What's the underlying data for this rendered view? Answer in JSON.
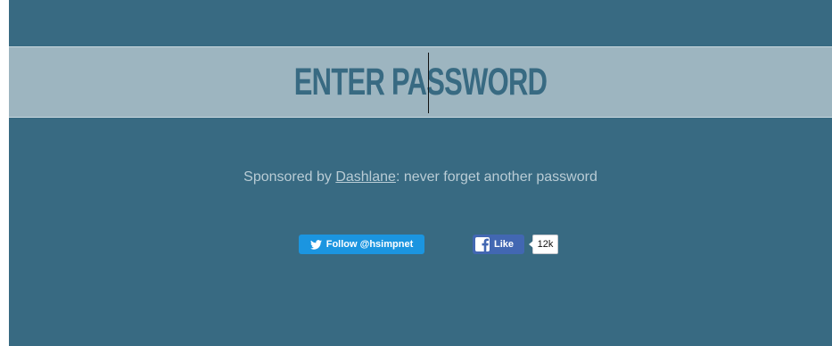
{
  "password": {
    "placeholder": "ENTER PASSWORD",
    "value": ""
  },
  "sponsor": {
    "prefix": "Sponsored by ",
    "link_text": "Dashlane",
    "suffix": ": never forget another password"
  },
  "social": {
    "twitter_label": "Follow @hsimpnet",
    "twitter_icon": "twitter-bird-icon",
    "facebook_label": "Like",
    "facebook_icon": "facebook-f-icon",
    "facebook_count": "12k"
  },
  "colors": {
    "background": "#386a82",
    "input_band": "#9db5c0",
    "text_muted": "#b9ccd5",
    "twitter_blue": "#1b95e0",
    "facebook_blue": "#4267b2"
  }
}
